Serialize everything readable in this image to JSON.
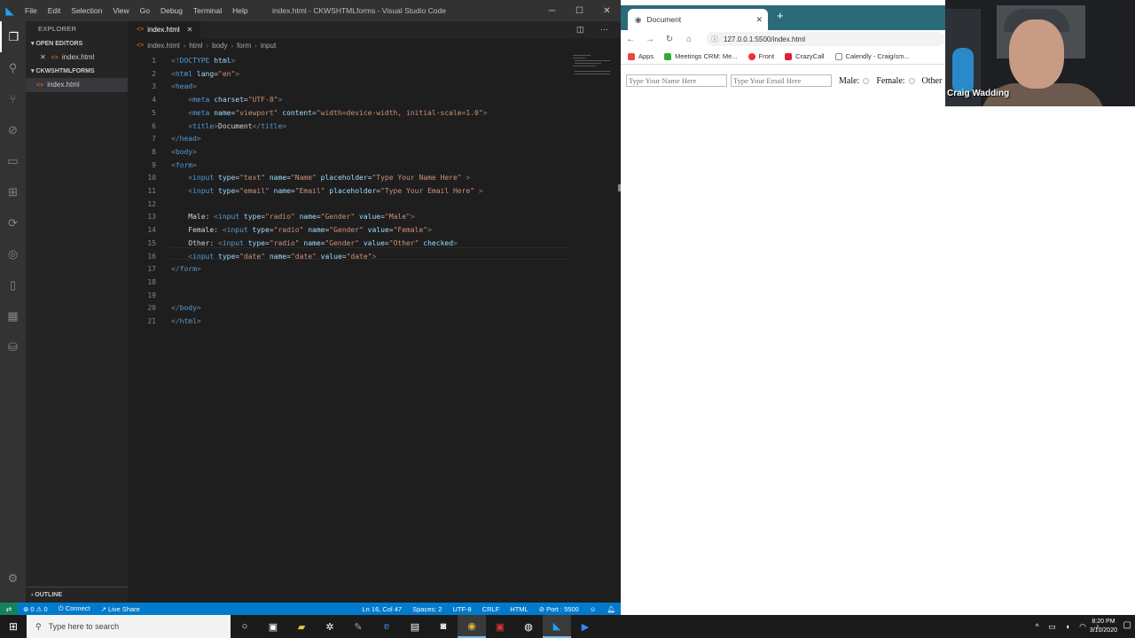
{
  "vscode": {
    "menus": [
      "File",
      "Edit",
      "Selection",
      "View",
      "Go",
      "Debug",
      "Terminal",
      "Help"
    ],
    "window_title": "index.html - CKWSHTMLforms - Visual Studio Code",
    "explorer": {
      "header": "EXPLORER",
      "open_editors": "OPEN EDITORS",
      "open_file": "index.html",
      "project": "CKWSHTMLFORMS",
      "project_file": "index.html",
      "outline": "OUTLINE"
    },
    "tab": {
      "label": "index.html"
    },
    "breadcrumb": [
      "index.html",
      "html",
      "body",
      "form",
      "input"
    ],
    "code_lines": [
      {
        "n": "1",
        "html": "<span class='t'>&lt;!</span><span class='tg'>DOCTYPE</span> <span class='at'>html</span><span class='t'>&gt;</span>",
        "indent": 0
      },
      {
        "n": "2",
        "html": "",
        "indent": 0
      },
      {
        "n": "3",
        "html": "",
        "indent": 0
      }
    ],
    "status": {
      "errors": "0",
      "warnings": "0",
      "connect": "Connect",
      "live": "Live Share",
      "position": "Ln 16, Col 47",
      "spaces": "Spaces: 2",
      "encoding": "UTF-8",
      "eol": "CRLF",
      "lang": "HTML",
      "port": "Port : 5500"
    }
  },
  "chrome": {
    "tab_title": "Document",
    "url": "127.0.0.1:5500/index.html",
    "bookmarks": [
      {
        "label": "Apps",
        "color": "#e44"
      },
      {
        "label": "Meetings CRM: Me...",
        "color": "#3a3"
      },
      {
        "label": "Front",
        "color": "#e33"
      },
      {
        "label": "CrazyCall",
        "color": "#d23"
      },
      {
        "label": "Calendly - Craig/sm...",
        "color": "#fff"
      }
    ],
    "form": {
      "name_placeholder": "Type Your Name Here",
      "email_placeholder": "Type Your Email Here",
      "male": "Male:",
      "female": "Female:",
      "other": "Other"
    }
  },
  "webcam": {
    "name": "Craig Wadding"
  },
  "taskbar": {
    "search": "Type here to search",
    "time": "8:20 PM",
    "date": "3/10/2020"
  }
}
